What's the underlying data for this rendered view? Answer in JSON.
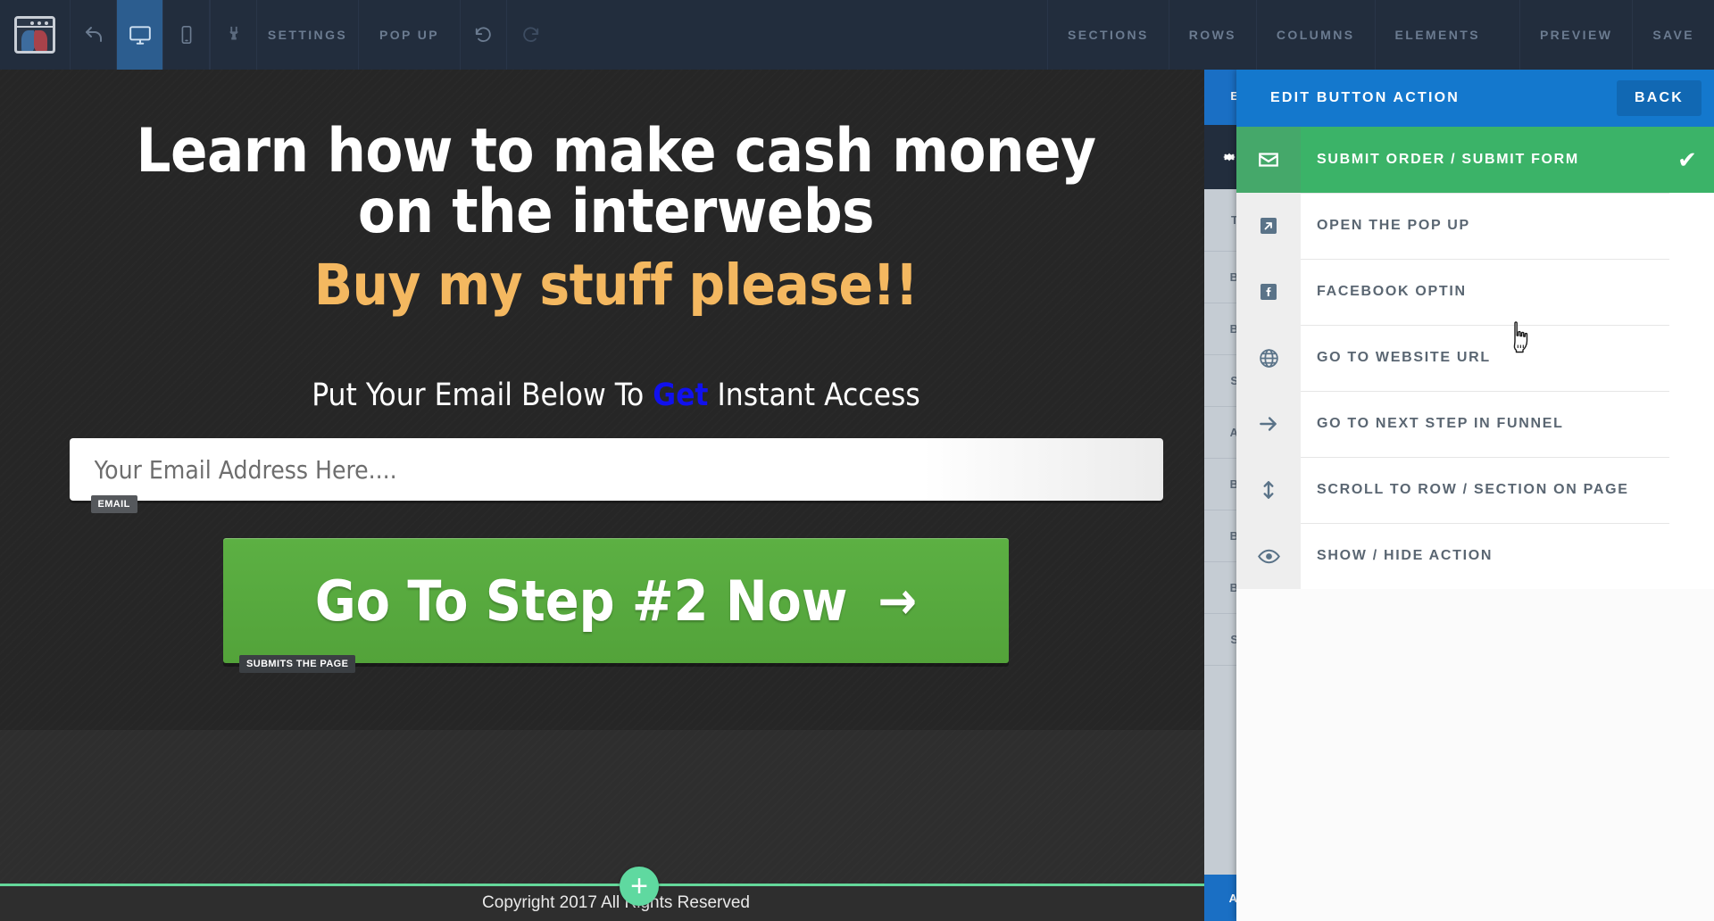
{
  "toolbar": {
    "logo_name": "clickfunnels-logo",
    "undo_label": "undo-icon",
    "desktop_label": "desktop-icon",
    "mobile_label": "mobile-icon",
    "plugin_label": "plug-icon",
    "settings_label": "SETTINGS",
    "popup_label": "POP UP",
    "history_back_label": "history-back-icon",
    "history_forward_label": "history-forward-icon",
    "sections_label": "SECTIONS",
    "rows_label": "ROWS",
    "columns_label": "COLUMNS",
    "elements_label": "ELEMENTS",
    "preview_label": "PREVIEW",
    "save_label": "SAVE"
  },
  "page": {
    "headline_line1": "Learn how to make cash money",
    "headline_line2": "on the interwebs",
    "headline_accent": "Buy my stuff please!!",
    "subhead_before": "Put Your Email Below To ",
    "subhead_highlight": "Get",
    "subhead_after": " Instant Access",
    "email_placeholder": "Your Email Address Here....",
    "email_value": "",
    "email_tag": "EMAIL",
    "cta_label": "Go To Step #2 Now",
    "cta_arrow": "→",
    "cta_tag": "SUBMITS THE PAGE",
    "footer_text": "Copyright 2017 All Rights Reserved",
    "add_section_label": "+",
    "colors": {
      "accent_orange": "#f4b860",
      "highlight_blue": "#1111ee",
      "cta_green": "#58ab3f",
      "footer_line_green": "#64d89a",
      "add_button_green": "#5fd9a0",
      "page_background": "#262626"
    }
  },
  "background_panel": {
    "rows": [
      "T",
      "B",
      "B",
      "S",
      "A",
      "B",
      "B",
      "B",
      "S"
    ],
    "footer_label": "A",
    "header_label": "E"
  },
  "action_panel": {
    "title": "EDIT BUTTON ACTION",
    "back_label": "BACK",
    "header_color": "#1478cd",
    "selected_color": "#3bb368",
    "items": [
      {
        "label": "SUBMIT ORDER / SUBMIT FORM",
        "icon": "envelope-icon",
        "selected": true
      },
      {
        "label": "OPEN THE POP UP",
        "icon": "external-link-icon",
        "selected": false
      },
      {
        "label": "FACEBOOK OPTIN",
        "icon": "facebook-icon",
        "selected": false
      },
      {
        "label": "GO TO WEBSITE URL",
        "icon": "globe-icon",
        "selected": false
      },
      {
        "label": "GO TO NEXT STEP IN FUNNEL",
        "icon": "arrow-right-icon",
        "selected": false
      },
      {
        "label": "SCROLL TO ROW / SECTION ON PAGE",
        "icon": "arrows-vertical-icon",
        "selected": false
      },
      {
        "label": "SHOW / HIDE ACTION",
        "icon": "eye-icon",
        "selected": false
      }
    ],
    "check_glyph": "✔"
  }
}
